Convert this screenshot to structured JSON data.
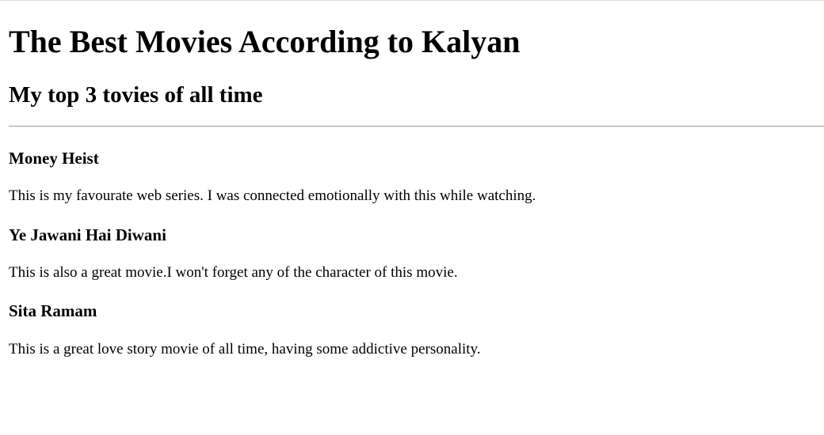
{
  "page": {
    "title": "The Best Movies According to Kalyan",
    "subtitle": "My top 3 tovies of all time"
  },
  "movies": [
    {
      "title": "Money Heist",
      "description": "This is my favourate web series. I was connected emotionally with this while watching."
    },
    {
      "title": "Ye Jawani Hai Diwani",
      "description": "This is also a great movie.I won't forget any of the character of this movie."
    },
    {
      "title": "Sita Ramam",
      "description": "This is a great love story movie of all time, having some addictive personality."
    }
  ]
}
